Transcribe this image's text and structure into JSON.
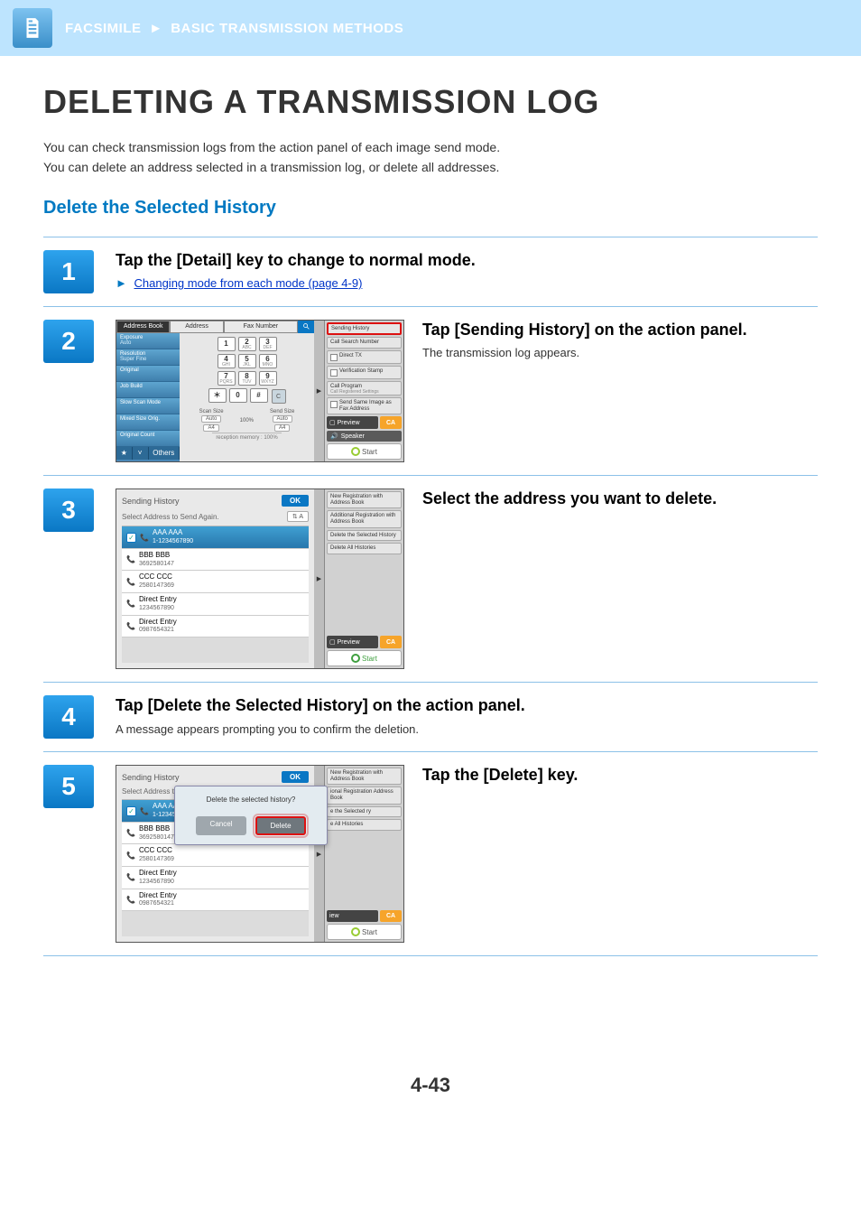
{
  "header": {
    "breadcrumb1": "FACSIMILE",
    "arrow": "►",
    "breadcrumb2": "BASIC TRANSMISSION METHODS"
  },
  "page": {
    "title": "DELETING A TRANSMISSION LOG",
    "intro1": "You can check transmission logs from the action panel of each image send mode.",
    "intro2": "You can delete an address selected in a transmission log, or delete all addresses.",
    "section_title": "Delete the Selected History",
    "page_num": "4-43"
  },
  "steps": {
    "s1": {
      "num": "1",
      "title": "Tap the [Detail] key to change to normal mode.",
      "link_prefix": "►",
      "link_text": "Changing mode from each mode (page 4-9)"
    },
    "s2": {
      "num": "2",
      "title": "Tap [Sending History] on the action panel.",
      "desc": "The transmission log appears."
    },
    "s3": {
      "num": "3",
      "title": "Select the address you want to delete."
    },
    "s4": {
      "num": "4",
      "title": "Tap [Delete the Selected History] on the action panel.",
      "desc": "A message appears prompting you to confirm the deletion."
    },
    "s5": {
      "num": "5",
      "title": "Tap the [Delete] key."
    }
  },
  "fax_screen": {
    "tabs": {
      "address_book": "Address Book",
      "address": "Address",
      "fax_number": "Fax Number"
    },
    "sidebar": {
      "exposure": "Exposure",
      "exposure_val": "Auto",
      "resolution": "Resolution",
      "resolution_val": "Super Fine",
      "original": "Original",
      "job_build": "Job Build",
      "slow_scan": "Slow Scan Mode",
      "mixed": "Mixed Size Orig.",
      "orig_count": "Original Count",
      "others": "Others"
    },
    "keypad": {
      "k1": "1",
      "k2": "2",
      "k2s": "ABC",
      "k3": "3",
      "k3s": "DEF",
      "k4": "4",
      "k4s": "GHI",
      "k5": "5",
      "k5s": "JKL",
      "k6": "6",
      "k6s": "MNO",
      "k7": "7",
      "k7s": "PQRS",
      "k8": "8",
      "k8s": "TUV",
      "k9": "9",
      "k9s": "WXYZ",
      "kstar": "＊",
      "k0": "0",
      "khash": "#",
      "clear": "C"
    },
    "scan": {
      "scan_label": "Scan Size",
      "send_label": "Send Size",
      "ratio": "100%",
      "auto": "Auto",
      "paper": "A4"
    },
    "memory": "reception memory :            100%",
    "action": {
      "sending_history": "Sending History",
      "call_search": "Call Search Number",
      "direct_tx": "Direct TX",
      "verif_stamp": "Verification Stamp",
      "call_program": "Call Program",
      "call_registered": "Call Registered Settings",
      "send_same": "Send Same Image as Fax Address",
      "preview": "Preview",
      "ca": "CA",
      "speaker": "Speaker",
      "start": "Start"
    }
  },
  "hist_screen": {
    "title": "Sending History",
    "ok": "OK",
    "subtitle_send": "Select Address to Send Again.",
    "subtitle_se": "Select Address to Se",
    "sort": "⇅ A",
    "items": [
      {
        "name": "AAA AAA",
        "phone": "1-1234567890"
      },
      {
        "name": "BBB BBB",
        "phone": "3692580147"
      },
      {
        "name": "CCC CCC",
        "phone": "2580147369"
      },
      {
        "name": "Direct Entry",
        "phone": "1234567890"
      },
      {
        "name": "Direct Entry",
        "phone": "0987654321"
      }
    ],
    "items5": [
      {
        "name": "AAA AAA",
        "phone": "1-1234567890"
      },
      {
        "name": "BBB BBB",
        "phone": "3692580147"
      },
      {
        "name": "CCC CCC",
        "phone": "2580147369"
      },
      {
        "name": "Direct Entry",
        "phone": "1234567890"
      },
      {
        "name": "Direct Entry",
        "phone": "0987654321"
      }
    ],
    "action": {
      "new_reg": "New Registration with Address Book",
      "add_reg": "Additional Registration with Address Book",
      "del_sel": "Delete the Selected History",
      "del_all": "Delete All Histories",
      "preview": "Preview",
      "ca": "CA",
      "start": "Start",
      "ional_reg": "ional Registration Address Book",
      "e_sel": "e the Selected ry",
      "e_all": "e All Histories",
      "iew": "iew"
    },
    "modal": {
      "msg": "Delete the selected history?",
      "cancel": "Cancel",
      "delete": "Delete"
    }
  }
}
